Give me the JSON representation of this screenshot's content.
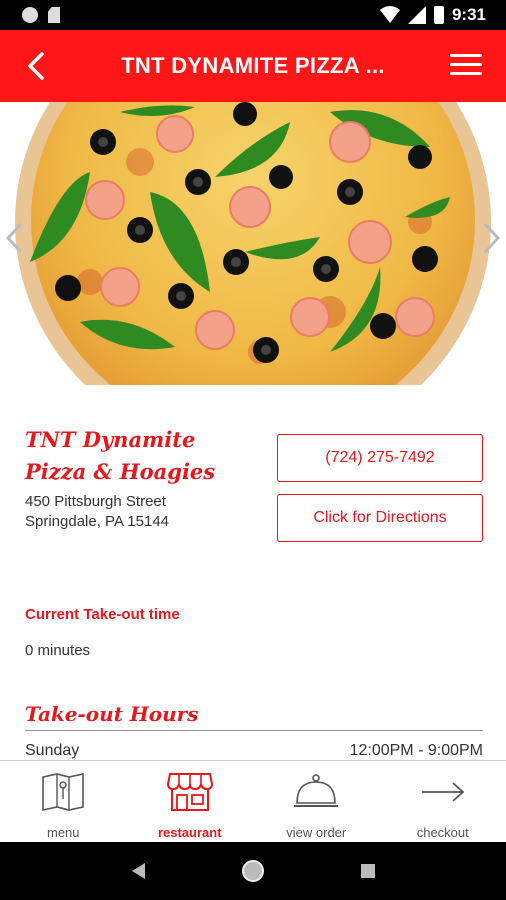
{
  "status_bar": {
    "time": "9:31",
    "icons": [
      "circle-notification-icon",
      "sd-card-icon",
      "wifi-icon",
      "signal-icon",
      "battery-icon"
    ]
  },
  "header": {
    "title": "TNT DYNAMITE PIZZA ...",
    "back_icon": "chevron-left-icon",
    "menu_icon": "hamburger-menu-icon",
    "color": "#ff1616"
  },
  "hero": {
    "image": "pizza-photo",
    "prev_icon": "chevron-left-icon",
    "next_icon": "chevron-right-icon"
  },
  "restaurant": {
    "name_line1": "TNT Dynamite",
    "name_line2": "Pizza & Hoagies",
    "address_line1": "450 Pittsburgh Street",
    "address_line2": "Springdale, PA 15144",
    "phone_label": "(724) 275-7492",
    "directions_label": "Click for Directions"
  },
  "takeout": {
    "label": "Current Take-out time",
    "value": "0 minutes"
  },
  "hours": {
    "title": "Take-out Hours",
    "rows": [
      {
        "day": "Sunday",
        "time": "12:00PM - 9:00PM"
      }
    ]
  },
  "bottom_nav": {
    "items": [
      {
        "label": "menu",
        "icon": "menu-book-icon",
        "active": false
      },
      {
        "label": "restaurant",
        "icon": "storefront-icon",
        "active": true
      },
      {
        "label": "view order",
        "icon": "cloche-icon",
        "active": false
      },
      {
        "label": "checkout",
        "icon": "arrow-right-icon",
        "active": false
      }
    ]
  },
  "accent_color": "#e8171b",
  "system_nav": [
    "back-triangle-icon",
    "home-circle-icon",
    "recents-square-icon"
  ]
}
